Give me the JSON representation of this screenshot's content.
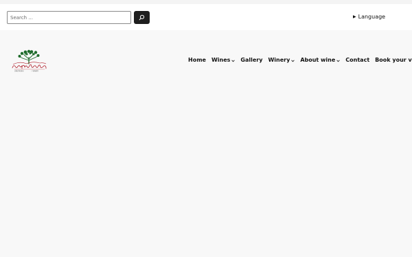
{
  "search": {
    "placeholder": "Search ...",
    "button_icon": "search-icon"
  },
  "language": {
    "label": "Language",
    "marker": "▶"
  },
  "logo": {
    "icon": "winery-logo",
    "tagline_left": "ΟΙΝΟΠΟΙΕΙΟ",
    "tagline_right": "WINERY",
    "colors": {
      "tree": "#1f6b2b",
      "text": "#b01e2a"
    }
  },
  "nav": {
    "items": [
      {
        "label": "Home",
        "dropdown": false
      },
      {
        "label": "Wines",
        "dropdown": true
      },
      {
        "label": "Gallery",
        "dropdown": false
      },
      {
        "label": "Winery",
        "dropdown": true
      },
      {
        "label": "About wine",
        "dropdown": true
      },
      {
        "label": "Contact",
        "dropdown": false
      },
      {
        "label": "Book your visit",
        "dropdown": true
      }
    ]
  },
  "colors": {
    "page_background": "#f8f8f8",
    "topbar_background": "#ffffff",
    "search_button": "#1e1e1e",
    "text": "#111111"
  }
}
